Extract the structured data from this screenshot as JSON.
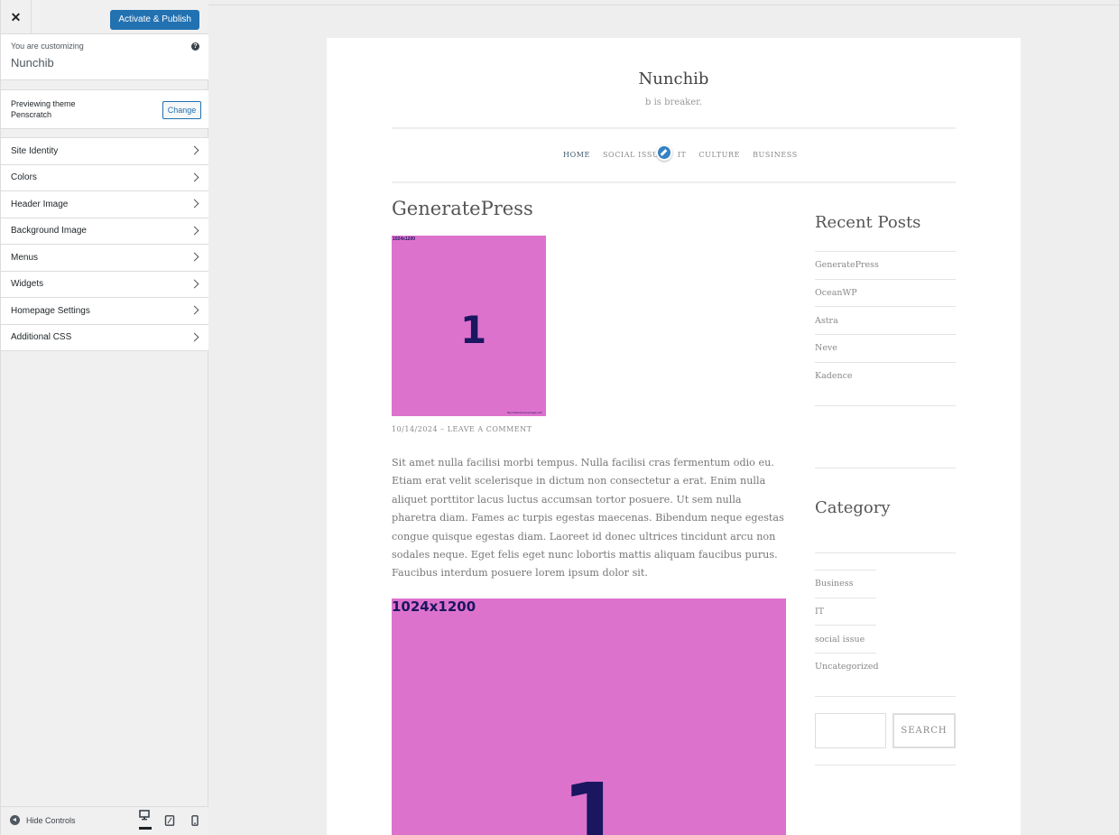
{
  "customizer": {
    "close_label": "✕",
    "publish_label": "Activate & Publish",
    "info": {
      "action": "You are customizing",
      "title": "Nunchib",
      "help": "?"
    },
    "theme": {
      "label": "Previewing theme",
      "name": "Penscratch",
      "change_label": "Change"
    },
    "panels": [
      {
        "label": "Site Identity"
      },
      {
        "label": "Colors"
      },
      {
        "label": "Header Image"
      },
      {
        "label": "Background Image"
      },
      {
        "label": "Menus"
      },
      {
        "label": "Widgets"
      },
      {
        "label": "Homepage Settings"
      },
      {
        "label": "Additional CSS"
      }
    ],
    "footer": {
      "hide_label": "Hide Controls",
      "active_device": "desktop"
    }
  },
  "site": {
    "title": "Nunchib",
    "description": "b is breaker.",
    "nav": [
      "HOME",
      "SOCIAL ISSUE",
      "IT",
      "CULTURE",
      "BUSINESS"
    ],
    "post": {
      "title": "GeneratePress",
      "thumb_dim": "1024x1200",
      "thumb_num": "1",
      "thumb_url": "http://www.dummyimage.com",
      "date": "10/14/2024",
      "meta_sep": "–",
      "comment_link": "LEAVE A COMMENT",
      "body": "Sit amet nulla facilisi morbi tempus. Nulla facilisi cras fermentum odio eu. Etiam erat velit scelerisque in dictum non consectetur a erat. Enim nulla aliquet porttitor lacus luctus accumsan tortor posuere. Ut sem nulla pharetra diam. Fames ac turpis egestas maecenas. Bibendum neque egestas congue quisque egestas diam. Laoreet id donec ultrices tincidunt arcu non sodales neque. Eget felis eget nunc lobortis mattis aliquam faucibus purus. Faucibus interdum posuere lorem ipsum dolor sit.",
      "image_dim": "1024x1200",
      "image_num": "1"
    },
    "recent_posts": {
      "title": "Recent Posts",
      "items": [
        "GeneratePress",
        "OceanWP",
        "Astra",
        "Neve",
        "Kadence"
      ]
    },
    "category": {
      "title": "Category",
      "items": [
        "Business",
        "IT",
        "social issue",
        "Uncategorized"
      ]
    },
    "search": {
      "button_label": "SEARCH"
    }
  },
  "colors": {
    "accent": "#2271b1",
    "image_bg": "#dd72cc",
    "image_fg": "#1a1660"
  }
}
